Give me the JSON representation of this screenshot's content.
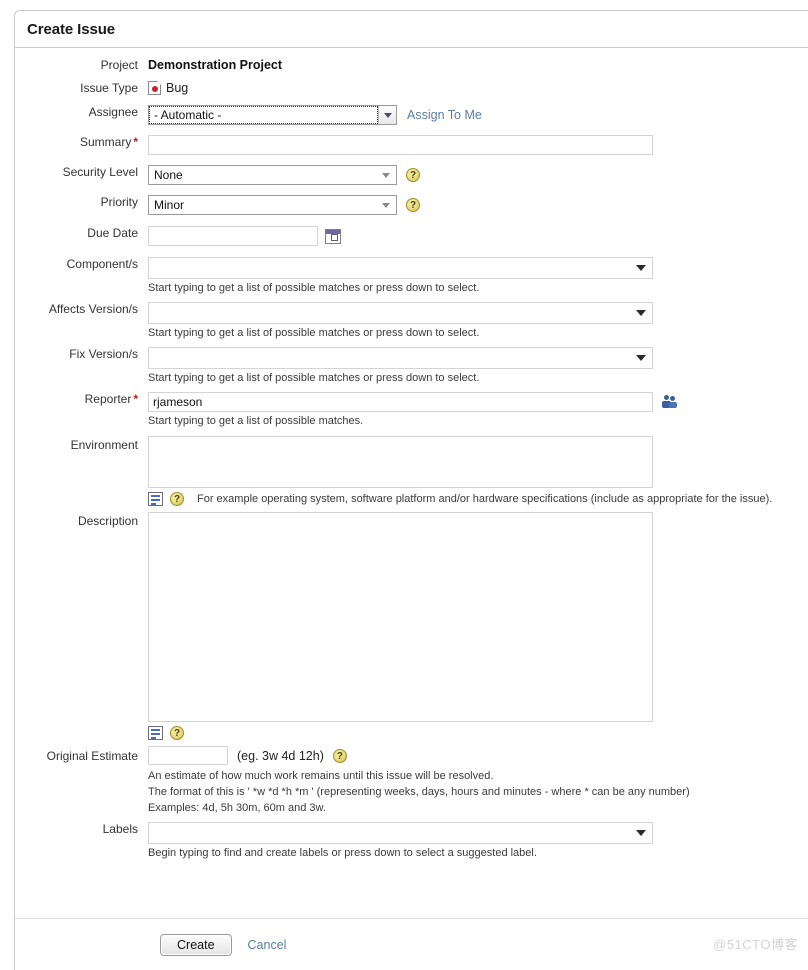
{
  "header": {
    "title": "Create Issue"
  },
  "fields": {
    "project": {
      "label": "Project",
      "value": "Demonstration Project"
    },
    "issue_type": {
      "label": "Issue Type",
      "value": "Bug",
      "icon": "bug-icon"
    },
    "assignee": {
      "label": "Assignee",
      "value": "- Automatic -",
      "assign_to_me": "Assign To Me"
    },
    "summary": {
      "label": "Summary",
      "value": "",
      "required": true
    },
    "security": {
      "label": "Security Level",
      "value": "None"
    },
    "priority": {
      "label": "Priority",
      "value": "Minor"
    },
    "due_date": {
      "label": "Due Date",
      "value": ""
    },
    "components": {
      "label": "Component/s",
      "value": "",
      "hint": "Start typing to get a list of possible matches or press down to select."
    },
    "affects_versions": {
      "label": "Affects Version/s",
      "value": "",
      "hint": "Start typing to get a list of possible matches or press down to select."
    },
    "fix_versions": {
      "label": "Fix Version/s",
      "value": "",
      "hint": "Start typing to get a list of possible matches or press down to select."
    },
    "reporter": {
      "label": "Reporter",
      "value": "rjameson",
      "required": true,
      "hint": "Start typing to get a list of possible matches."
    },
    "environment": {
      "label": "Environment",
      "value": "",
      "hint": "For example operating system, software platform and/or hardware specifications (include as appropriate for the issue)."
    },
    "description": {
      "label": "Description",
      "value": ""
    },
    "original_estimate": {
      "label": "Original Estimate",
      "value": "",
      "example": "(eg. 3w 4d 12h)",
      "hint1": "An estimate of how much work remains until this issue will be resolved.",
      "hint2": "The format of this is ' *w *d *h *m ' (representing weeks, days, hours and minutes - where * can be any number)",
      "hint3": "Examples: 4d, 5h 30m, 60m and 3w."
    },
    "labels": {
      "label": "Labels",
      "value": "",
      "hint": "Begin typing to find and create labels or press down to select a suggested label."
    }
  },
  "help_glyph": "?",
  "footer": {
    "create_label": "Create",
    "cancel_label": "Cancel"
  },
  "watermark": "@51CTO博客"
}
